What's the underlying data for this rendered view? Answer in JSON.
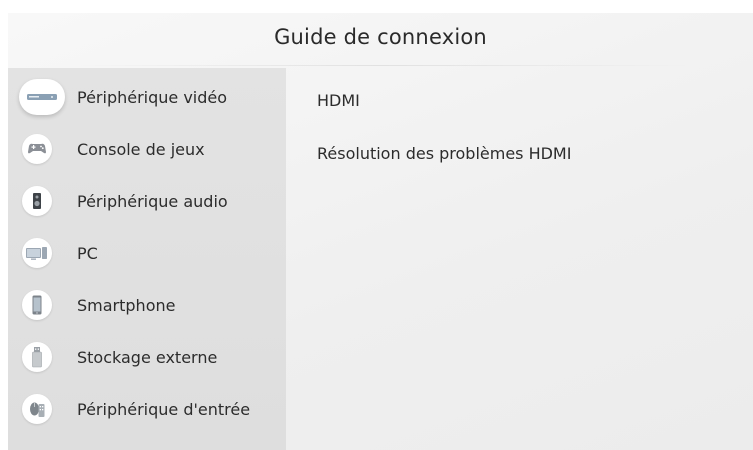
{
  "header": {
    "title": "Guide de connexion"
  },
  "sidebar": {
    "items": [
      {
        "label": "Périphérique vidéo",
        "icon": "video-device-icon",
        "selected": true
      },
      {
        "label": "Console de jeux",
        "icon": "gamepad-icon",
        "selected": false
      },
      {
        "label": "Périphérique audio",
        "icon": "speaker-icon",
        "selected": false
      },
      {
        "label": "PC",
        "icon": "pc-icon",
        "selected": false
      },
      {
        "label": "Smartphone",
        "icon": "smartphone-icon",
        "selected": false
      },
      {
        "label": "Stockage externe",
        "icon": "usb-storage-icon",
        "selected": false
      },
      {
        "label": "Périphérique d'entrée",
        "icon": "input-device-icon",
        "selected": false
      }
    ]
  },
  "content": {
    "items": [
      {
        "label": "HDMI"
      },
      {
        "label": "Résolution des problèmes HDMI"
      }
    ]
  }
}
